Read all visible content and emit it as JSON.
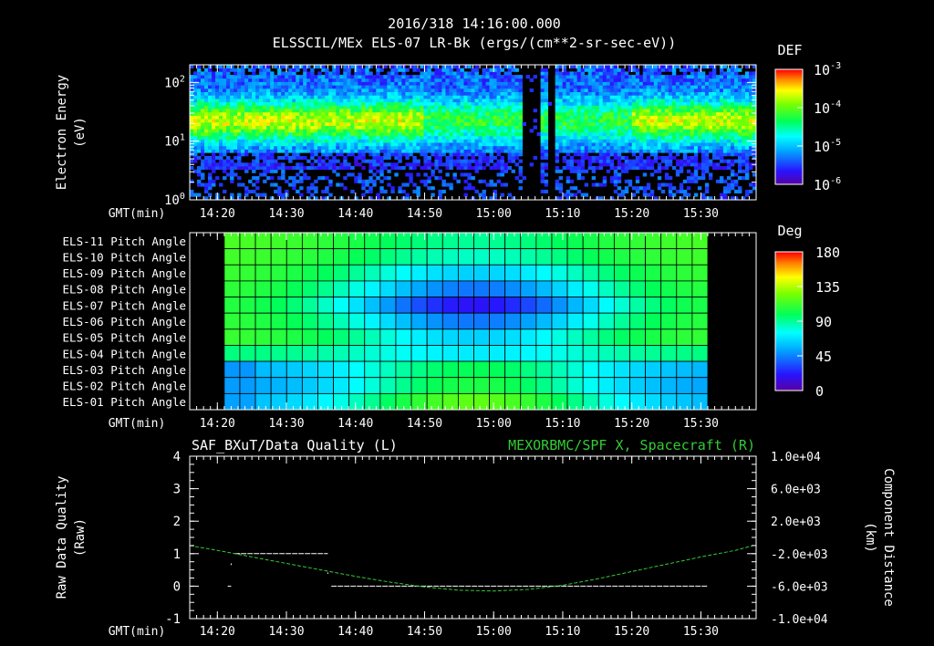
{
  "header": {
    "timestamp": "2016/318 14:16:00.000",
    "title": "ELSSCIL/MEx ELS-07 LR-Bk  (ergs/(cm**2-sr-sec-eV))"
  },
  "time_axis": {
    "label": "GMT(min)",
    "ticks": [
      "14:20",
      "14:30",
      "14:40",
      "14:50",
      "15:00",
      "15:10",
      "15:20",
      "15:30"
    ]
  },
  "colors": {
    "background": "#000000",
    "green_trace": "#33cc33",
    "white_trace": "#ffffff",
    "grid": "#000000"
  },
  "chart_data": [
    {
      "type": "heatmap",
      "name": "energy-spectrogram",
      "ylabel_line1": "Electron Energy",
      "ylabel_line2": "(eV)",
      "y_scale": "log",
      "ylim": [
        1,
        200
      ],
      "y_ticks": [
        {
          "value": 1,
          "base": "10",
          "exp": "0"
        },
        {
          "value": 10,
          "base": "10",
          "exp": "1"
        },
        {
          "value": 100,
          "base": "10",
          "exp": "2"
        }
      ],
      "xlim": [
        "14:16",
        "15:38"
      ],
      "data_gaps": [
        [
          "15:04",
          "15:07"
        ],
        [
          "15:08",
          "15:09"
        ]
      ],
      "colorbar": {
        "title": "DEF",
        "scale": "log",
        "range": [
          1e-06,
          0.001
        ],
        "ticks": [
          {
            "base": "10",
            "exp": "-3"
          },
          {
            "base": "10",
            "exp": "-4"
          },
          {
            "base": "10",
            "exp": "-5"
          },
          {
            "base": "10",
            "exp": "-6"
          }
        ]
      }
    },
    {
      "type": "heatmap",
      "name": "pitch-angle",
      "rows": [
        "ELS-11 Pitch Angle",
        "ELS-10 Pitch Angle",
        "ELS-09 Pitch Angle",
        "ELS-08 Pitch Angle",
        "ELS-07 Pitch Angle",
        "ELS-06 Pitch Angle",
        "ELS-05 Pitch Angle",
        "ELS-04 Pitch Angle",
        "ELS-03 Pitch Angle",
        "ELS-02 Pitch Angle",
        "ELS-01 Pitch Angle"
      ],
      "xlim": [
        "14:16",
        "15:38"
      ],
      "data_range": [
        "14:21",
        "15:31"
      ],
      "colorbar": {
        "title": "Deg",
        "range": [
          0,
          180
        ],
        "ticks": [
          "180",
          "135",
          "90",
          "45",
          "0"
        ]
      }
    },
    {
      "type": "line",
      "name": "data-quality-and-position",
      "legend_left": "SAF_BXuT/Data Quality (L)",
      "legend_right": "MEXORBMC/SPF X, Spacecraft (R)",
      "ylabel_left_line1": "Raw Data Quality",
      "ylabel_left_line2": "(Raw)",
      "ylabel_right_line1": "Component Distance",
      "ylabel_right_line2": "(km)",
      "ylim_left": [
        -1,
        4
      ],
      "y_ticks_left": [
        "4",
        "3",
        "2",
        "1",
        "0",
        "-1"
      ],
      "ylim_right": [
        -10000,
        10000
      ],
      "y_ticks_right": [
        "1.0e+04",
        "6.0e+03",
        "2.0e+03",
        "-2.0e+03",
        "-6.0e+03",
        "-1.0e+04"
      ],
      "series": [
        {
          "name": "SAF_BXuT/Data Quality",
          "axis": "left",
          "segments": [
            {
              "x": [
                "14:22:30",
                "14:36:00"
              ],
              "y": [
                1,
                1
              ]
            },
            {
              "x": [
                "14:36:30",
                "15:31:00"
              ],
              "y": [
                0,
                0
              ]
            },
            {
              "x": [
                "14:21:30",
                "14:22:00"
              ],
              "y": [
                0,
                0
              ]
            }
          ]
        },
        {
          "name": "MEXORBMC/SPF X, Spacecraft",
          "axis": "right",
          "x": [
            "14:16",
            "14:20",
            "14:25",
            "14:30",
            "14:35",
            "14:40",
            "14:45",
            "14:50",
            "14:55",
            "15:00",
            "15:05",
            "15:10",
            "15:15",
            "15:20",
            "15:25",
            "15:30",
            "15:35",
            "15:38"
          ],
          "y": [
            -1000,
            -1600,
            -2400,
            -3200,
            -4000,
            -4800,
            -5500,
            -6100,
            -6500,
            -6600,
            -6400,
            -5900,
            -5100,
            -4200,
            -3300,
            -2400,
            -1600,
            -900
          ]
        }
      ]
    }
  ]
}
